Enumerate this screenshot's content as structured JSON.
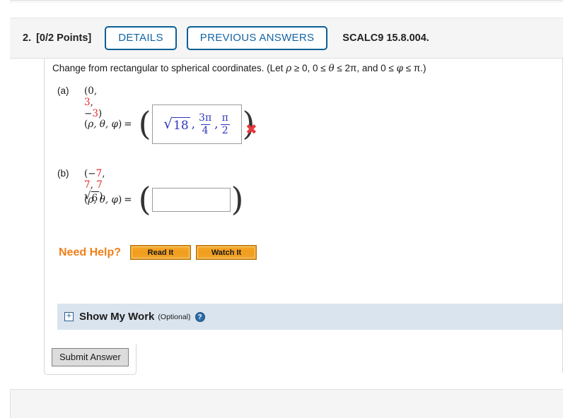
{
  "header": {
    "question_number": "2.",
    "points": "[0/2 Points]",
    "details_label": "DETAILS",
    "previous_answers_label": "PREVIOUS ANSWERS",
    "textbook_code": "SCALC9 15.8.004.",
    "accent_color": "#0a6096"
  },
  "prompt": {
    "text_before": "Change from rectangular to spherical coordinates. (Let ",
    "rho": "ρ",
    "cond1": " ≥ 0, 0 ≤ ",
    "theta": "θ",
    "cond2": " ≤ 2π, and 0 ≤ ",
    "phi": "φ",
    "cond3": " ≤ π.)"
  },
  "parts": [
    {
      "label": "(a)",
      "coords": {
        "open": "(",
        "x": "0",
        "x_color": "black",
        "sep1": ", ",
        "y": "3",
        "y_color": "red",
        "sep2": ", ",
        "z_sign": "−",
        "z": "3",
        "z_color": "red",
        "close": ")"
      },
      "answer_label_open": "(",
      "answer_label": "ρ, θ, φ",
      "answer_label_close": ")",
      "equals": "=",
      "answer": {
        "filled": true,
        "rho_radicand": "18",
        "theta_num": "3π",
        "theta_den": "4",
        "phi_num": "π",
        "phi_den": "2",
        "color": "#2e36bb"
      },
      "status_icon": "✖",
      "status_icon_name": "incorrect-x-icon",
      "status_color": "#e8383c"
    },
    {
      "label": "(b)",
      "coords": {
        "open": "(",
        "x_sign": "−",
        "x": "7",
        "x_color": "red",
        "sep1": ", ",
        "y": "7",
        "y_color": "red",
        "sep2": ", ",
        "z_coef": "7",
        "z_radicand": "6",
        "z_color": "red",
        "close": ")"
      },
      "answer_label_open": "(",
      "answer_label": "ρ, θ, φ",
      "answer_label_close": ")",
      "equals": "=",
      "answer": {
        "filled": false,
        "value": "",
        "placeholder": ""
      }
    }
  ],
  "need_help": {
    "label": "Need Help?",
    "label_color": "#f07f18",
    "buttons": [
      {
        "label": "Read It",
        "name": "read-it-button"
      },
      {
        "label": "Watch It",
        "name": "watch-it-button"
      }
    ]
  },
  "show_my_work": {
    "expand_icon": "+",
    "title": "Show My Work",
    "optional": "(Optional)",
    "help_icon": "?",
    "background_color": "#dae4ee"
  },
  "submit": {
    "label": "Submit Answer"
  }
}
